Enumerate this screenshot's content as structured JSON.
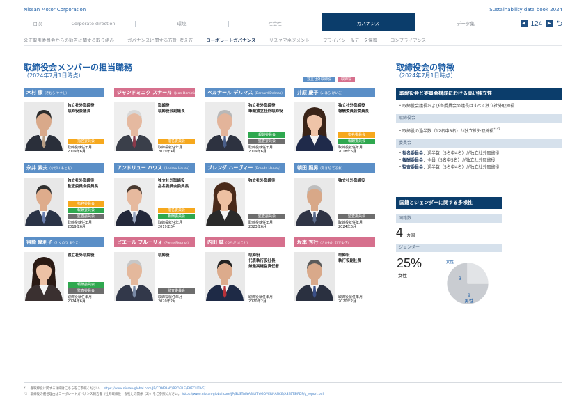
{
  "header": {
    "brand": "Nissan Motor Corporation",
    "book": "Sustainability data book 2024"
  },
  "main_tabs": [
    {
      "label": "目次",
      "w": 40
    },
    {
      "label": "Corporate direction",
      "w": 120
    },
    {
      "label": "環境",
      "w": 134
    },
    {
      "label": "社会性",
      "w": 134
    },
    {
      "label": "ガバナンス",
      "w": 134,
      "active": true
    },
    {
      "label": "データ集",
      "w": 146
    }
  ],
  "pager": {
    "prev": "◀",
    "page": "124",
    "next": "▶",
    "back": "⮌"
  },
  "sub_tabs": [
    {
      "label": "公正取引委員会からの勧告に関する取り組み"
    },
    {
      "label": "ガバナンスに関する方針･考え方"
    },
    {
      "label": "コーポレートガバナンス",
      "active": true
    },
    {
      "label": "リスクマネジメント"
    },
    {
      "label": "プライバシー＆データ保護"
    },
    {
      "label": "コンプライアンス"
    }
  ],
  "left": {
    "title": "取締役会メンバーの担当職務",
    "subtitle": "（2024年7月1日時点）",
    "legend": {
      "independent": "独立社外取締役",
      "director": "取締役"
    }
  },
  "members": [
    {
      "name": "木村 康",
      "kana": "（きむら やすし）",
      "type": "ind",
      "roles": [
        "独立社外取締役",
        "取締役会議長"
      ],
      "badges": [
        {
          "label": "指名委員会",
          "color": "orange"
        }
      ],
      "since": [
        "取締役就任年月",
        "2019年6月"
      ],
      "photo": {
        "skin": "#d9a98a",
        "hair": "#2b2b2b",
        "suit": "#2a2f3a",
        "tie": "#b99f86",
        "bg": "#e9e9e9"
      }
    },
    {
      "name": "ジャンドミニク スナール",
      "kana": "（Jean-Dominique Senard）",
      "type": "dir",
      "roles": [
        "取締役",
        "取締役会副議長"
      ],
      "badges": [
        {
          "label": "指名委員会",
          "color": "orange"
        }
      ],
      "since": [
        "取締役就任年月",
        "2019年4月"
      ],
      "photo": {
        "skin": "#e5b9a0",
        "hair": "#d8d8d8",
        "suit": "#3a3f4a",
        "tie": "#8a3a4a",
        "bg": "#eeeeee"
      }
    },
    {
      "name": "ベルナール デルマス",
      "kana": "（Bernard Delmas）",
      "type": "ind",
      "roles": [
        "独立社外取締役",
        "筆頭独立社外取締役"
      ],
      "badges": [
        {
          "label": "報酬委員会",
          "color": "green"
        },
        {
          "label": "監査委員会",
          "color": "gray"
        }
      ],
      "since": [
        "取締役就任年月",
        "2019年6月"
      ],
      "photo": {
        "skin": "#e3b49a",
        "hair": "#b8b8b8",
        "suit": "#2d3240",
        "tie": "#4a5f8a",
        "bg": "#ebebeb"
      }
    },
    {
      "name": "井原 慶子",
      "kana": "（いはら けいこ）",
      "type": "ind",
      "roles": [
        "独立社外取締役",
        "報酬委員会委員長"
      ],
      "badges": [
        {
          "label": "指名委員会",
          "color": "orange"
        },
        {
          "label": "報酬委員会",
          "color": "green"
        }
      ],
      "since": [
        "取締役就任年月",
        "2018年6月"
      ],
      "photo": {
        "skin": "#efc4a8",
        "hair": "#3a2418",
        "suit": "#1f2a4a",
        "tie": "#d23a3a",
        "bg": "#eeeeee"
      }
    },
    {
      "name": "永井 素夫",
      "kana": "（ながい もとお）",
      "type": "ind",
      "roles": [
        "独立社外取締役",
        "監査委員会委員長"
      ],
      "badges": [
        {
          "label": "指名委員会",
          "color": "orange"
        },
        {
          "label": "報酬委員会",
          "color": "green"
        },
        {
          "label": "監査委員会",
          "color": "gray"
        }
      ],
      "since": [
        "取締役就任年月",
        "2019年6月"
      ],
      "photo": {
        "skin": "#deac8c",
        "hair": "#303030",
        "suit": "#2a3346",
        "tie": "#6a7fae",
        "bg": "#e8e8e8"
      }
    },
    {
      "name": "アンドリュー ハウス",
      "kana": "（Andrew House）",
      "type": "ind",
      "roles": [
        "独立社外取締役",
        "指名委員会委員長"
      ],
      "badges": [
        {
          "label": "指名委員会",
          "color": "orange"
        },
        {
          "label": "報酬委員会",
          "color": "green"
        }
      ],
      "since": [
        "取締役就任年月",
        "2019年6月"
      ],
      "photo": {
        "skin": "#e6b99e",
        "hair": "#4a3a30",
        "suit": "#23283a",
        "tie": "#9aa6bf",
        "bg": "#ececec"
      }
    },
    {
      "name": "ブレンダ ハーヴィー",
      "kana": "（Brenda Harvey）",
      "type": "ind",
      "roles": [
        "独立社外取締役"
      ],
      "badges": [
        {
          "label": "監査委員会",
          "color": "gray"
        }
      ],
      "since": [
        "取締役就任年月",
        "2023年6月"
      ],
      "photo": {
        "skin": "#edc0a2",
        "hair": "#4a2a1a",
        "suit": "#2a2a2a",
        "tie": "#2a2a2a",
        "bg": "#ededed"
      }
    },
    {
      "name": "朝田 照男",
      "kana": "（あさだ てるお）",
      "type": "ind",
      "roles": [
        "独立社外取締役"
      ],
      "badges": [
        {
          "label": "監査委員会",
          "color": "gray"
        }
      ],
      "since": [
        "取締役就任年月",
        "2024年6月"
      ],
      "photo": {
        "skin": "#d8a888",
        "hair": "#bdbdbd",
        "suit": "#2f3445",
        "tie": "#5a6a8a",
        "bg": "#e9e9e9"
      }
    },
    {
      "name": "得能 摩利子",
      "kana": "（とくのう まりこ）",
      "type": "ind",
      "roles": [
        "独立社外取締役"
      ],
      "badges": [
        {
          "label": "報酬委員会",
          "color": "green"
        },
        {
          "label": "監査委員会",
          "color": "gray"
        }
      ],
      "since": [
        "取締役就任年月",
        "2024年6月"
      ],
      "photo": {
        "skin": "#ecc1a5",
        "hair": "#2a1a14",
        "suit": "#3a3030",
        "tie": "#3a3030",
        "bg": "#ededed"
      }
    },
    {
      "name": "ピエール フルーリォ",
      "kana": "（Pierre Fleuriot）",
      "type": "dir",
      "roles": [
        "取締役"
      ],
      "badges": [
        {
          "label": "監査委員会",
          "color": "gray"
        }
      ],
      "since": [
        "取締役就任年月",
        "2020年2月"
      ],
      "photo": {
        "skin": "#e4b89c",
        "hair": "#c7c7c7",
        "suit": "#32384a",
        "tie": "#7a8aa6",
        "bg": "#ebebeb"
      }
    },
    {
      "name": "内田 誠",
      "kana": "（うちだ まこと）",
      "type": "dir",
      "roles": [
        "取締役",
        "代表執行役社長",
        "兼最高経営責任者"
      ],
      "badges": [],
      "since": [
        "取締役就任年月",
        "2020年2月"
      ],
      "photo": {
        "skin": "#dcab8c",
        "hair": "#222222",
        "suit": "#1e2a46",
        "tie": "#b8323a",
        "bg": "#e9e9e9"
      }
    },
    {
      "name": "坂本 秀行",
      "kana": "（さかもと ひでゆき）",
      "type": "dir",
      "roles": [
        "取締役",
        "執行役副社長"
      ],
      "badges": [],
      "since": [
        "取締役就任年月",
        "2020年2月"
      ],
      "photo": {
        "skin": "#d9a98a",
        "hair": "#5a5a5a",
        "suit": "#2a3040",
        "tie": "#3a4f86",
        "bg": "#e8e8e8"
      }
    }
  ],
  "right": {
    "title": "取締役会の特徴",
    "subtitle": "（2024年7月1日時点）",
    "section1": {
      "header": "取締役会と委員会構成における高い独立性",
      "text1": "・取締役会議長および各委員会の議長はすべて独立社外取締役",
      "board_label": "取締役会",
      "board_text": "・取締役の過半数（12名中8名）が独立社外取締役",
      "board_sup": "*1*2",
      "committee_label": "委員会",
      "committees": [
        {
          "name": "指名委員会",
          "text": "：過半数（5名中4名）が独立社外取締役"
        },
        {
          "name": "報酬委員会",
          "text": "：全員（5名中5名）が独立社外取締役"
        },
        {
          "name": "監査委員会",
          "text": "：過半数（5名中4名）が独立社外取締役"
        }
      ]
    },
    "section2": {
      "header": "国籍とジェンダーに関する多様性",
      "nationality_label": "国籍数",
      "nationality_value": "4",
      "nationality_unit": "カ国",
      "gender_label": "ジェンダー",
      "female_pct": "25%",
      "female_label": "女性",
      "pie": {
        "female_label": "女性",
        "female": 3,
        "male": 9,
        "male_label": "男性"
      }
    }
  },
  "footnotes": [
    {
      "text": "*1　各取締役に関する詳細はこちらをご参照ください。",
      "link": "https://www.nissan-global.com/JP/COMPANY/PROFILE/EXECUTIVE/"
    },
    {
      "text": "*2　取締役の選任理由はコーポレートガバナンス報告書（社外取締役　会社との関係（2））をご参照ください。",
      "link": "https://www.nissan-global.com/JP/SUSTAINABILITY/GOVERNANCE/ASSETS/PDF/g_report.pdf"
    }
  ],
  "colors": {
    "accent": "#1f5fa6",
    "navy": "#0b3d6b",
    "independent": "#5b8fc7",
    "director": "#d6708d",
    "orange": "#f6a81d",
    "green": "#2fa84f",
    "gray": "#6e6e6e",
    "pie_male": "#c9ccd1",
    "pie_female": "#e2e4e7"
  }
}
